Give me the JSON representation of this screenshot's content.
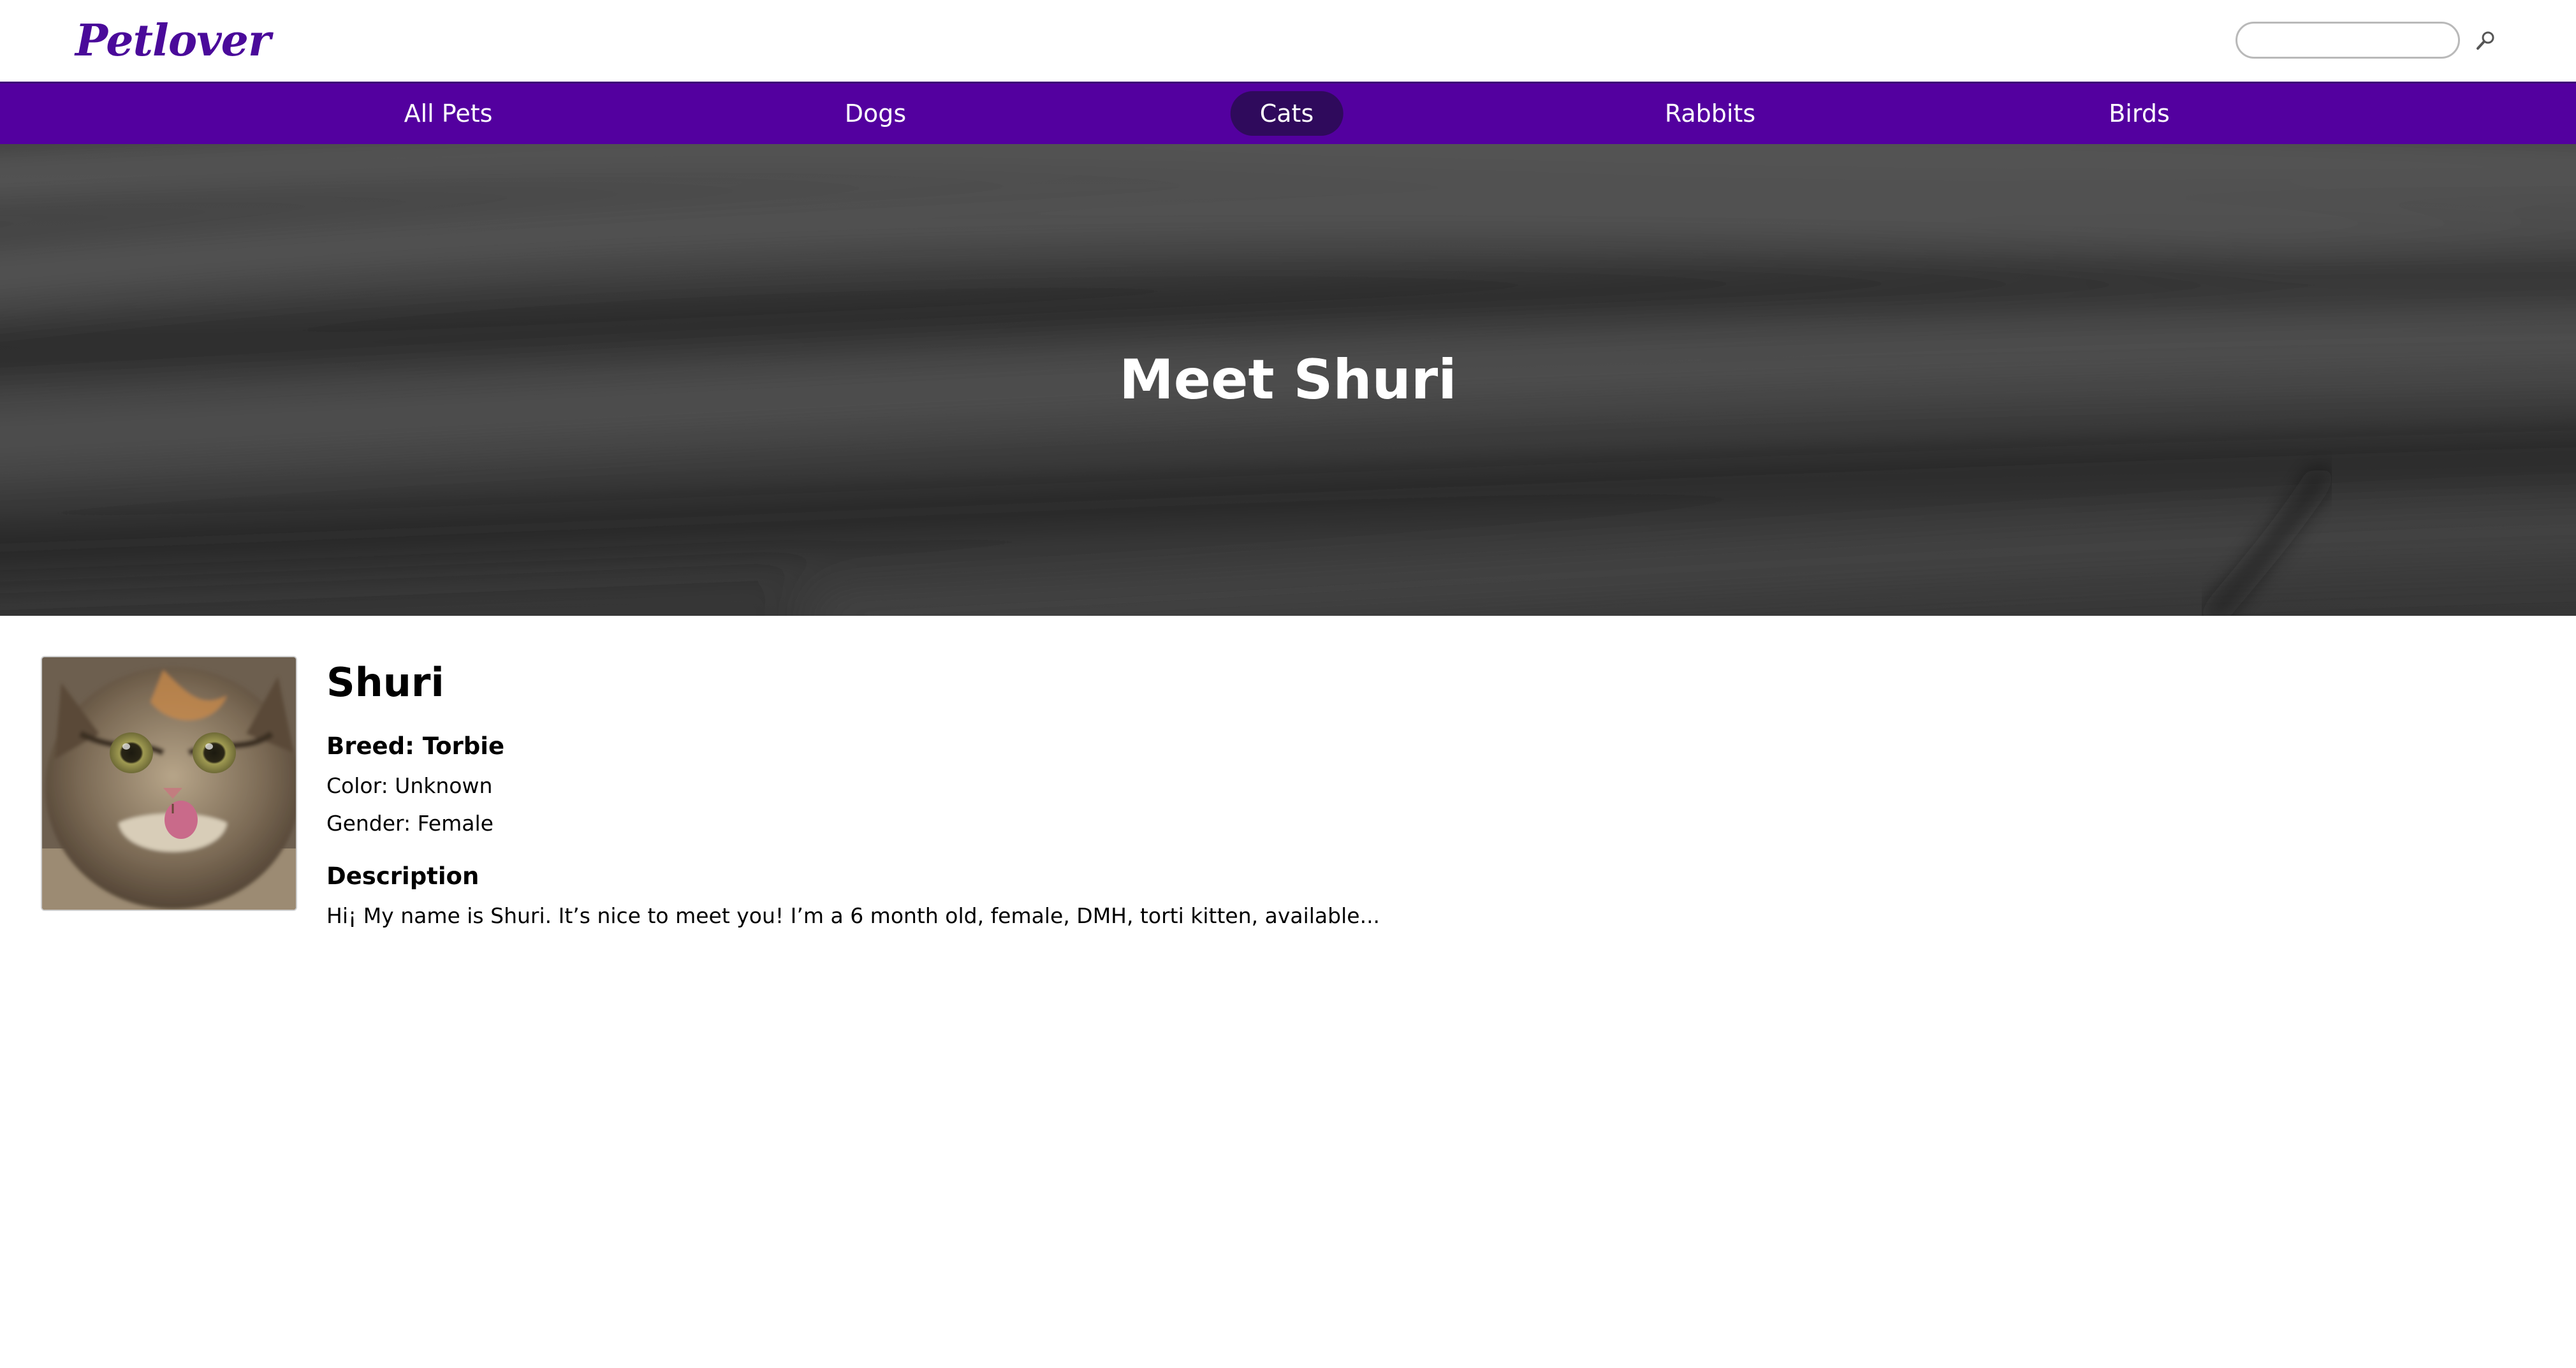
{
  "header": {
    "logo": "Petlover",
    "search": {
      "placeholder": "",
      "value": ""
    }
  },
  "nav": {
    "items": [
      {
        "label": "All Pets",
        "active": false
      },
      {
        "label": "Dogs",
        "active": false
      },
      {
        "label": "Cats",
        "active": true
      },
      {
        "label": "Rabbits",
        "active": false
      },
      {
        "label": "Birds",
        "active": false
      }
    ]
  },
  "hero": {
    "title": "Meet Shuri"
  },
  "pet": {
    "name": "Shuri",
    "breed": "Breed: Torbie",
    "color": "Color: Unknown",
    "gender": "Gender: Female",
    "description_heading": "Description",
    "description": "Hi¡ My name is Shuri. It’s nice to meet you! I’m a 6 month old, female, DMH, torti kitten, available..."
  },
  "colors": {
    "brand": "#4a0a9a",
    "nav_background": "#53009f",
    "nav_active": "#2f0a5c",
    "hero_overlay": "#3c3c3c"
  },
  "icons": {
    "search": "magnifier-icon"
  }
}
